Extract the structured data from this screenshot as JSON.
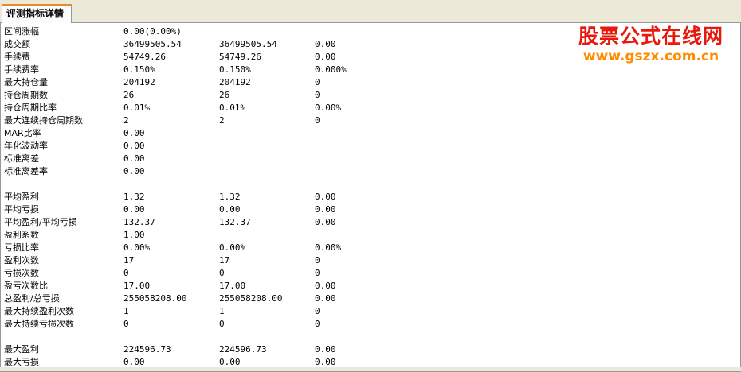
{
  "tabs": [
    {
      "label": "评测指标详情"
    }
  ],
  "watermark": {
    "title": "股票公式在线网",
    "url": "www.gszx.com.cn",
    "title_color": "#e8180c",
    "url_color": "#ff8c00"
  },
  "rows": [
    [
      "区间涨幅",
      "0.00(0.00%)",
      "",
      ""
    ],
    [
      "成交额",
      "36499505.54",
      "36499505.54",
      "0.00"
    ],
    [
      "手续费",
      "54749.26",
      "54749.26",
      "0.00"
    ],
    [
      "手续费率",
      "0.150%",
      "0.150%",
      "0.000%"
    ],
    [
      "最大持仓量",
      "204192",
      "204192",
      "0"
    ],
    [
      "持仓周期数",
      "26",
      "26",
      "0"
    ],
    [
      "持仓周期比率",
      "0.01%",
      "0.01%",
      "0.00%"
    ],
    [
      "最大连续持仓周期数",
      "2",
      "2",
      "0"
    ],
    [
      "MAR比率",
      "0.00",
      "",
      ""
    ],
    [
      "年化波动率",
      "0.00",
      "",
      ""
    ],
    [
      "标准离差",
      "0.00",
      "",
      ""
    ],
    [
      "标准离差率",
      "0.00",
      "",
      ""
    ],
    [
      "",
      "",
      "",
      ""
    ],
    [
      "平均盈利",
      "1.32",
      "1.32",
      "0.00"
    ],
    [
      "平均亏损",
      "0.00",
      "0.00",
      "0.00"
    ],
    [
      "平均盈利/平均亏损",
      "132.37",
      "132.37",
      "0.00"
    ],
    [
      "盈利系数",
      "1.00",
      "",
      ""
    ],
    [
      "亏损比率",
      "0.00%",
      "0.00%",
      "0.00%"
    ],
    [
      "盈利次数",
      "17",
      "17",
      "0"
    ],
    [
      "亏损次数",
      "0",
      "0",
      "0"
    ],
    [
      "盈亏次数比",
      "17.00",
      "17.00",
      "0.00"
    ],
    [
      "总盈利/总亏损",
      "255058208.00",
      "255058208.00",
      "0.00"
    ],
    [
      "最大持续盈利次数",
      "1",
      "1",
      "0"
    ],
    [
      "最大持续亏损次数",
      "0",
      "0",
      "0"
    ],
    [
      "",
      "",
      "",
      ""
    ],
    [
      "最大盈利",
      "224596.73",
      "224596.73",
      "0.00"
    ],
    [
      "最大亏损",
      "0.00",
      "0.00",
      "0.00"
    ]
  ]
}
